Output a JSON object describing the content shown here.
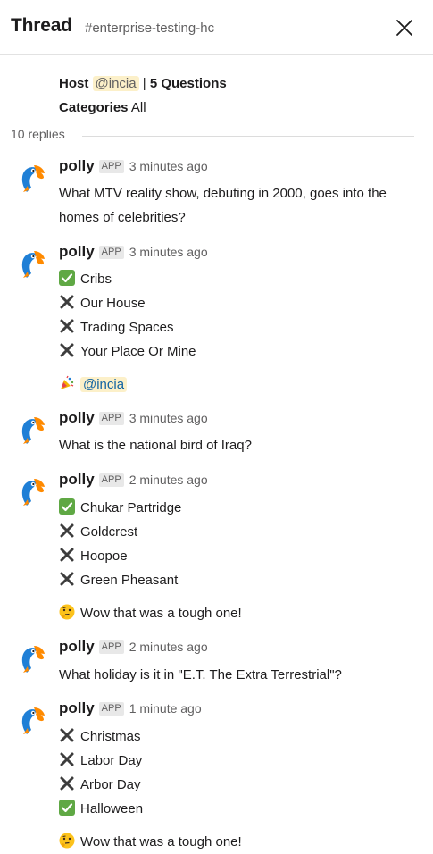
{
  "header": {
    "title": "Thread",
    "channel": "#enterprise-testing-hc"
  },
  "parent": {
    "host_label": "Host",
    "host_mention": "@incia",
    "separator": "|",
    "questions": "5 Questions",
    "categories_label": "Categories",
    "categories_value": "All"
  },
  "replies_count": "10 replies",
  "messages": [
    {
      "sender": "polly",
      "badge": "APP",
      "time": "3 minutes ago",
      "text": "What MTV reality show, debuting in 2000, goes into the homes of celebrities?"
    },
    {
      "sender": "polly",
      "badge": "APP",
      "time": "3 minutes ago",
      "answers": [
        "Cribs",
        "Our House",
        "Trading Spaces",
        "Your Place Or Mine"
      ],
      "footer_mention": "@incia"
    },
    {
      "sender": "polly",
      "badge": "APP",
      "time": "3 minutes ago",
      "text": "What is the national bird of Iraq?"
    },
    {
      "sender": "polly",
      "badge": "APP",
      "time": "2 minutes ago",
      "answers": [
        "Chukar Partridge",
        "Goldcrest",
        "Hoopoe",
        "Green Pheasant"
      ],
      "footer_text": "Wow that was a tough one!"
    },
    {
      "sender": "polly",
      "badge": "APP",
      "time": "2 minutes ago",
      "text": "What holiday is it in \"E.T. The Extra Terrestrial\"?"
    },
    {
      "sender": "polly",
      "badge": "APP",
      "time": "1 minute ago",
      "answers": [
        "Christmas",
        "Labor Day",
        "Arbor Day",
        "Halloween"
      ],
      "footer_text": "Wow that was a tough one!"
    }
  ],
  "icons": {
    "correct": "check-mark-icon",
    "wrong": "cross-mark-icon",
    "celebrate": "party-popper-icon",
    "thinking": "thinking-face-icon",
    "avatar": "parrot-avatar-icon"
  },
  "colors": {
    "correct": "#5fa844",
    "wrong": "#3d3d3d",
    "mention_bg": "#fcf0c9",
    "mention_fg": "#1264a3",
    "parrot_blue": "#1f7fd6",
    "parrot_orange": "#ff8a00"
  }
}
